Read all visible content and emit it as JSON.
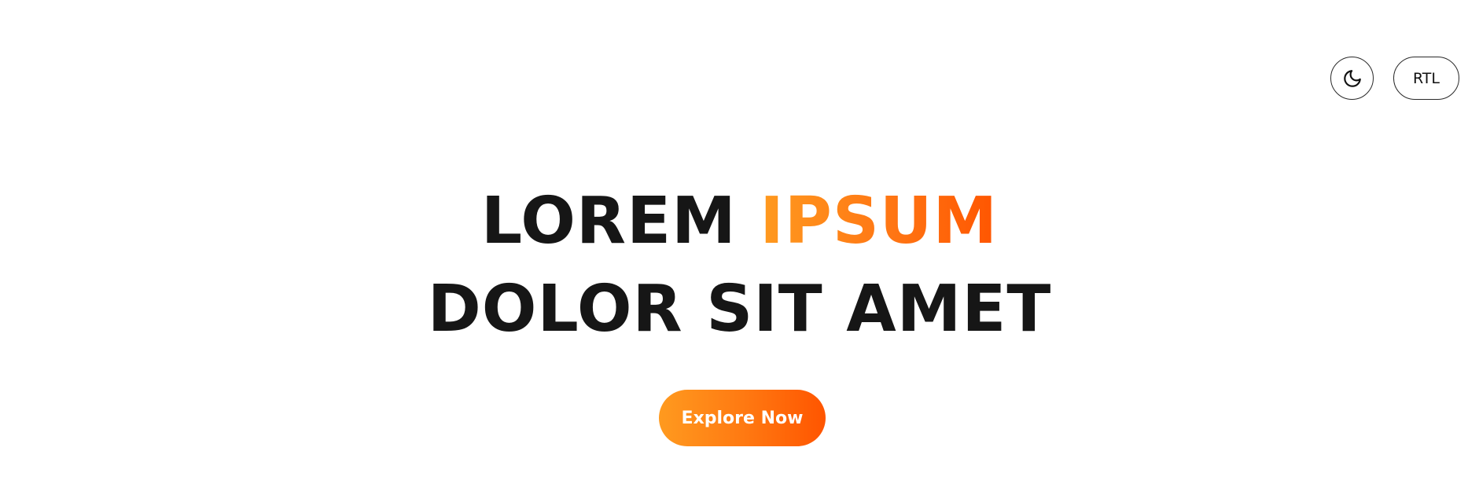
{
  "header": {
    "theme_toggle_icon": "moon-icon",
    "rtl_label": "RTL"
  },
  "hero": {
    "line1_plain": "LOREM",
    "line1_accent": "IPSUM",
    "line2": "DOLOR SIT AMET",
    "cta_label": "Explore Now"
  },
  "colors": {
    "accent_start": "#ff9a1f",
    "accent_end": "#ff5500",
    "heading": "#161616",
    "background": "#ffffff"
  }
}
